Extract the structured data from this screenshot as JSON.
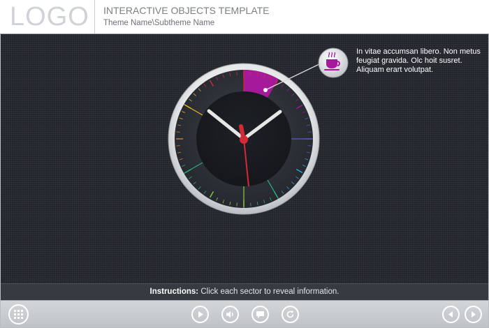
{
  "header": {
    "logo": "LOGO",
    "title": "INTERACTIVE OBJECTS TEMPLATE",
    "subtitle": "Theme Name\\Subtheme Name"
  },
  "clock": {
    "highlight_color": "#a5199a",
    "hand_color": "#e8e8e8",
    "second_hand_color": "#d42a36",
    "sector_colors": [
      "#d42a36",
      "#a5199a",
      "#5a5ad2",
      "#2aa7d6",
      "#27b07a",
      "#8fc63f",
      "#27b07a",
      "#e07f25",
      "#e8b52a",
      "#d42a36"
    ]
  },
  "callout": {
    "icon": "coffee-cup-icon",
    "text": "In vitae accumsan libero. Non metus feugiat gravida. Olc hoit susret. Aliquam erart volutpat."
  },
  "instructions": {
    "label": "Instructions:",
    "text": " Click each sector to reveal information."
  },
  "toolbar": {
    "menu_icon": "grid-menu-icon",
    "play_icon": "play-icon",
    "volume_icon": "volume-icon",
    "captions_icon": "captions-icon",
    "replay_icon": "replay-icon",
    "prev_icon": "prev-icon",
    "next_icon": "next-icon"
  }
}
